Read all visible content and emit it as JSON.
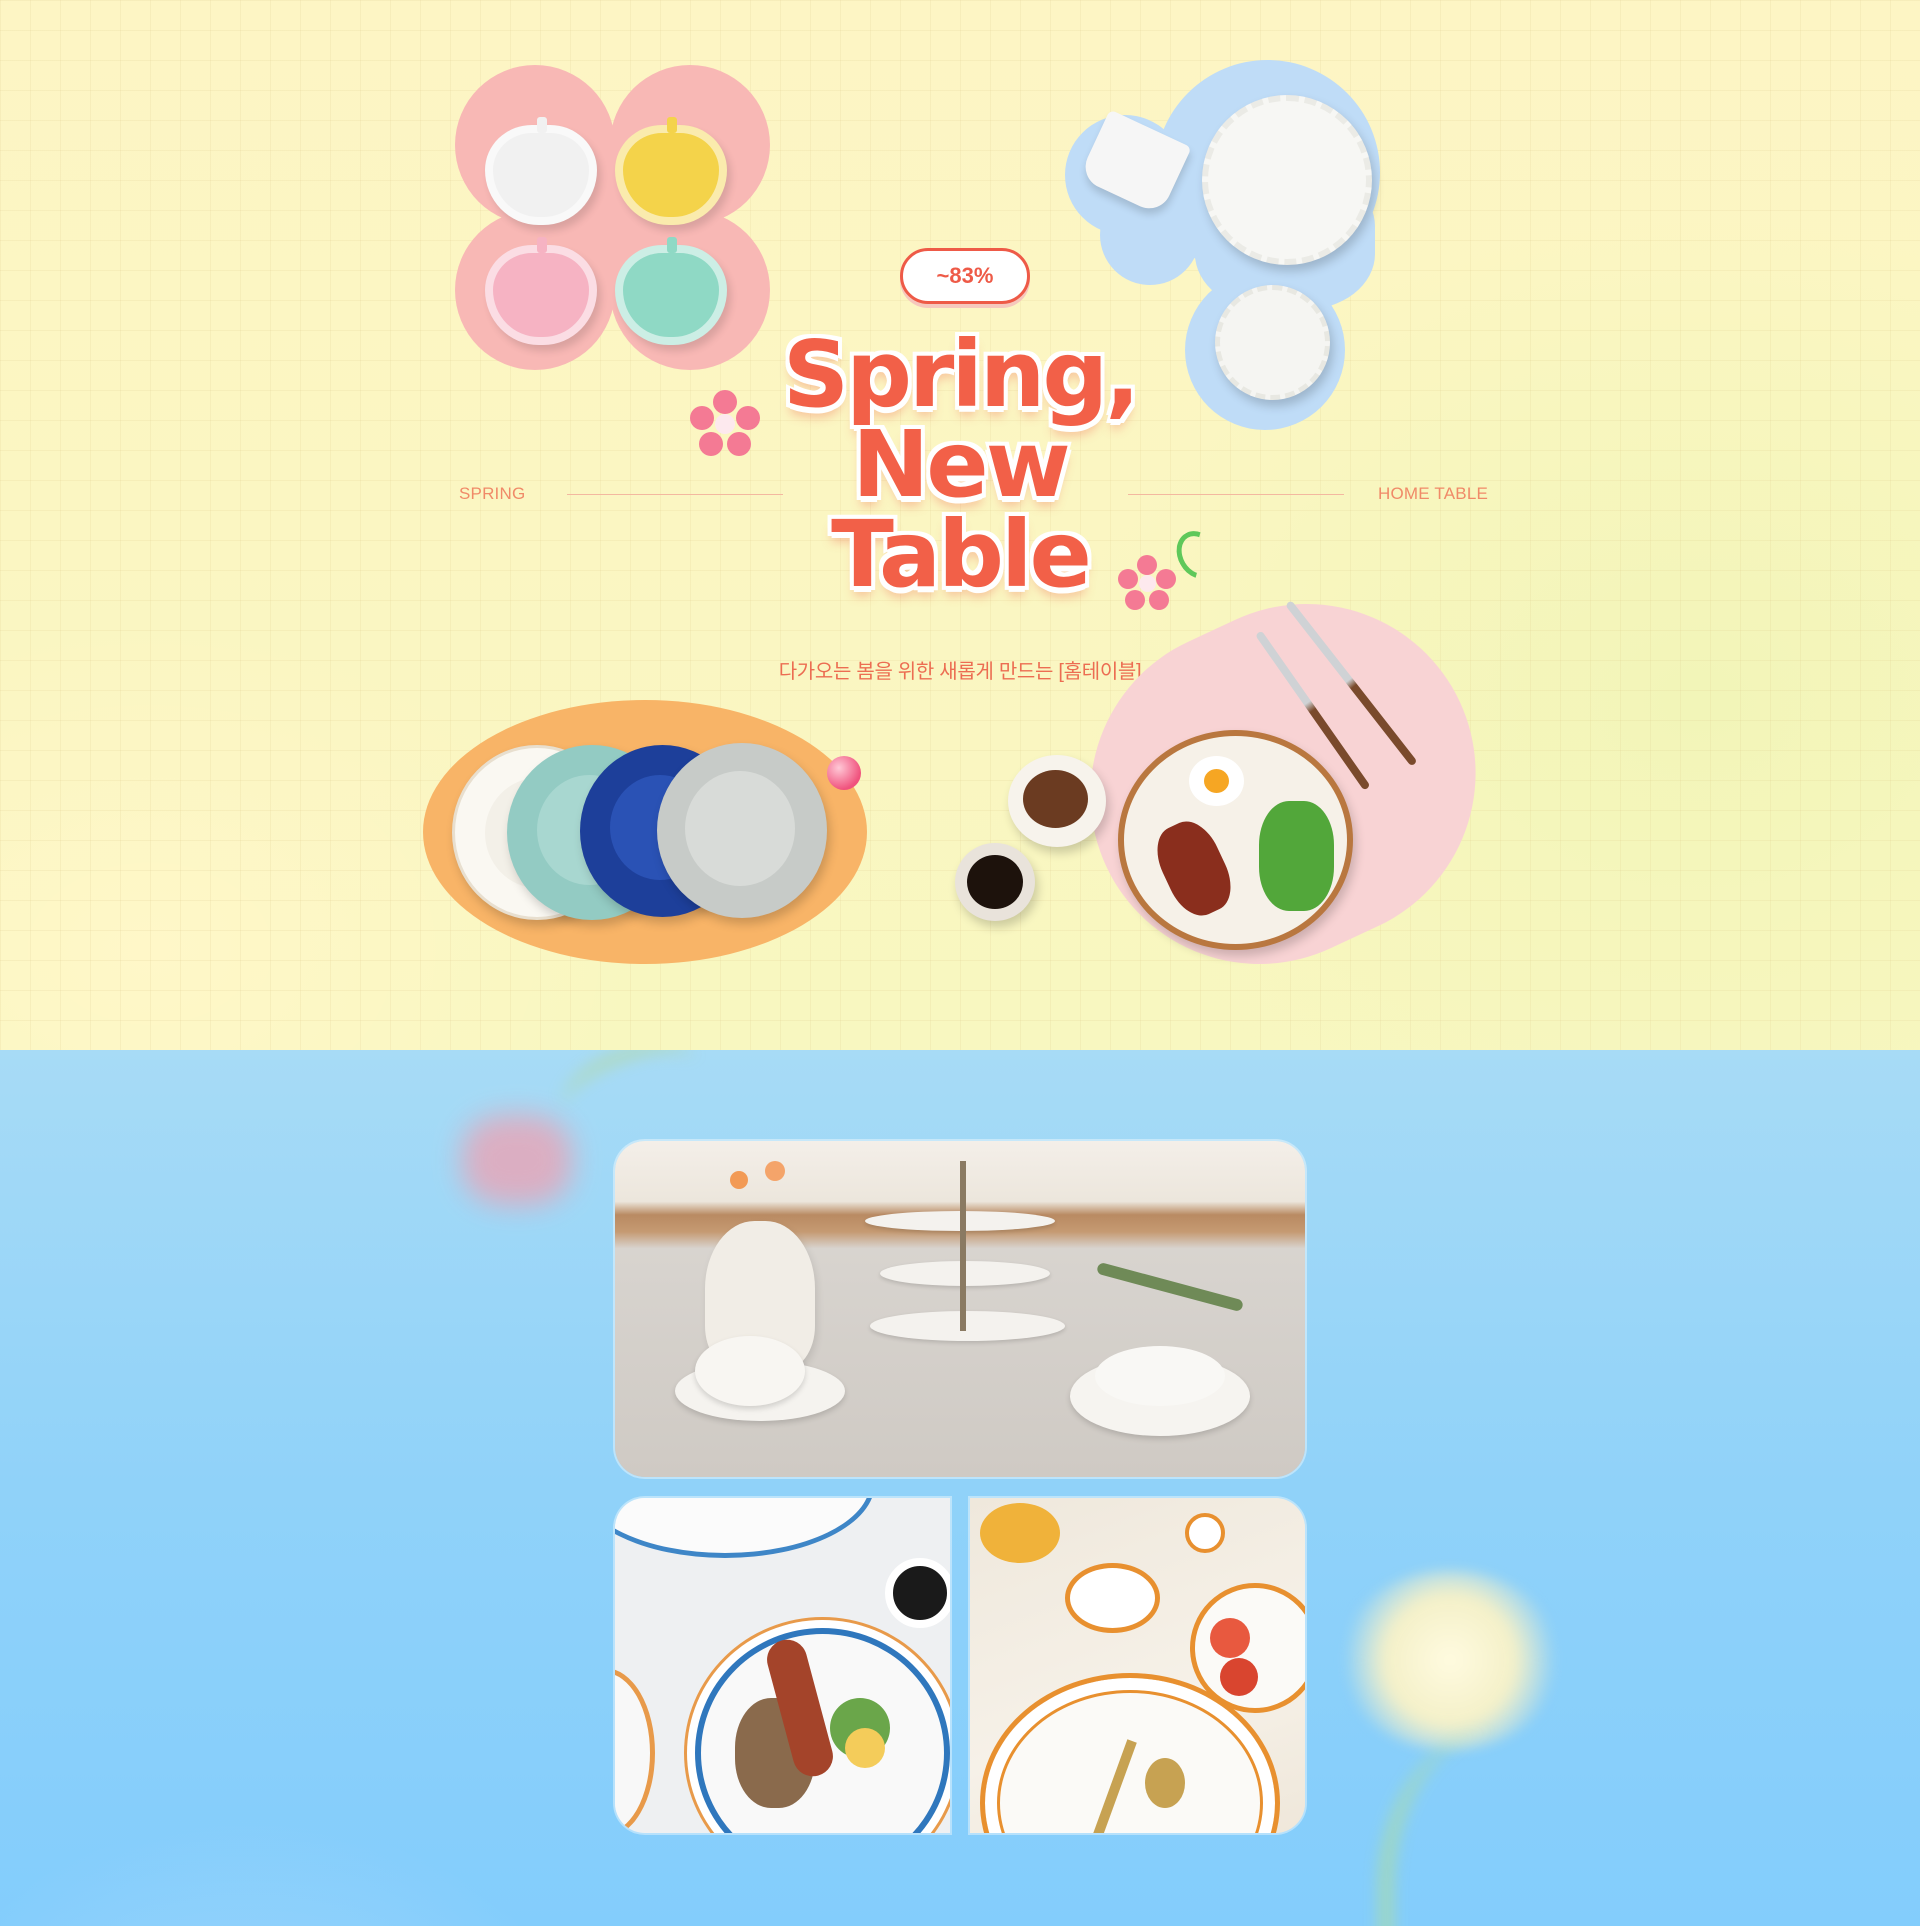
{
  "hero": {
    "badge": "~83%",
    "title_lines": [
      "Spring,",
      "New",
      "Table"
    ],
    "subtitle": "다가오는 봄을 위한 새롭게 만드는 [홈테이블]",
    "left_label": "SPRING",
    "right_label": "HOME TABLE"
  },
  "colors": {
    "accent": "#f26048",
    "hero_bg": "#fbf6c2",
    "lower_bg": "#90d2f9",
    "pink_blob": "#f8b8b5",
    "blue_blob": "#bfdcf7",
    "orange_oval": "#f8b467"
  },
  "icons": [
    "flower-icon",
    "apple-dish-icon",
    "plate-icon",
    "cutlery-icon",
    "cup-icon"
  ]
}
